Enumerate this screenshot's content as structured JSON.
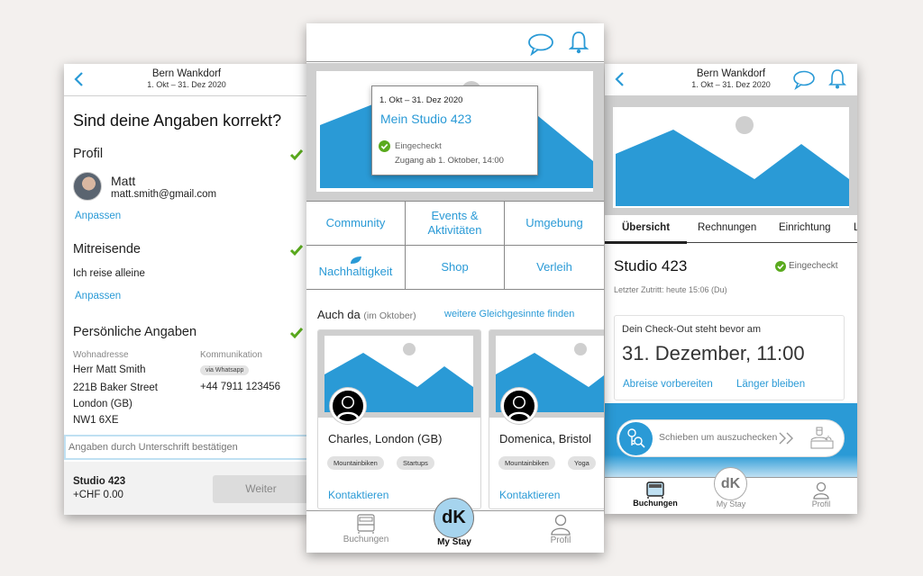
{
  "colors": {
    "accent": "#2a9ad6",
    "check": "#5aaa1e",
    "background": "#f3f0ee"
  },
  "left": {
    "header": {
      "title": "Bern Wankdorf",
      "dates": "1. Okt – 31. Dez 2020"
    },
    "question": "Sind deine Angaben korrekt?",
    "profile": {
      "title": "Profil",
      "name": "Matt",
      "email": "matt.smith@gmail.com",
      "edit": "Anpassen"
    },
    "companions": {
      "title": "Mitreisende",
      "text": "Ich reise alleine",
      "edit": "Anpassen"
    },
    "personal": {
      "title": "Persönliche Angaben",
      "address_label": "Wohnadresse",
      "address": [
        "Herr Matt Smith",
        "221B Baker Street",
        "London (GB)",
        "NW1 6XE"
      ],
      "comm_label": "Kommunikation",
      "comm_badge": "via Whatsapp",
      "phone": "+44 7911 123456"
    },
    "signature_placeholder": "Angaben durch Unterschrift bestätigen",
    "footer": {
      "studio": "Studio 423",
      "price": "+CHF 0.00",
      "next": "Weiter"
    }
  },
  "center": {
    "popup": {
      "dates": "1. Okt – 31. Dez 2020",
      "name": "Mein Studio 423",
      "status": "Eingecheckt",
      "access": "Zugang ab 1. Oktober,  14:00"
    },
    "menu": [
      {
        "label": "Community"
      },
      {
        "label": "Events & Aktivitäten"
      },
      {
        "label": "Umgebung"
      },
      {
        "label": "Nachhaltigkeit",
        "icon": "leaf-icon"
      },
      {
        "label": "Shop"
      },
      {
        "label": "Verleih"
      }
    ],
    "also_here": {
      "title": "Auch da",
      "subtitle": "(im Oktober)",
      "link": "weitere Gleichgesinnte finden"
    },
    "cards": [
      {
        "name": "Charles, London (GB)",
        "tags": [
          "Mountainbiken",
          "Startups"
        ],
        "action": "Kontaktieren"
      },
      {
        "name": "Domenica, Bristol",
        "tags": [
          "Mountainbiken",
          "Yoga"
        ],
        "action": "Kontaktieren"
      }
    ],
    "nav": {
      "bookings": "Buchungen",
      "mystay": "My Stay",
      "profile": "Profil",
      "logo": "dK"
    }
  },
  "right": {
    "header": {
      "title": "Bern Wankdorf",
      "dates": "1. Okt – 31. Dez 2020"
    },
    "tabs": [
      "Übersicht",
      "Rechnungen",
      "Einrichtung",
      "L"
    ],
    "studio": "Studio 423",
    "status": "Eingecheckt",
    "last_access": "Letzter Zutritt: heute 15:06 (Du)",
    "checkout": {
      "label": "Dein Check-Out steht bevor am",
      "date": "31. Dezember, 11:00",
      "prepare": "Abreise vorbereiten",
      "extend": "Länger bleiben"
    },
    "slider_label": "Schieben um auszuchecken",
    "nav": {
      "bookings": "Buchungen",
      "mystay": "My Stay",
      "profile": "Profil",
      "logo": "dK"
    }
  }
}
